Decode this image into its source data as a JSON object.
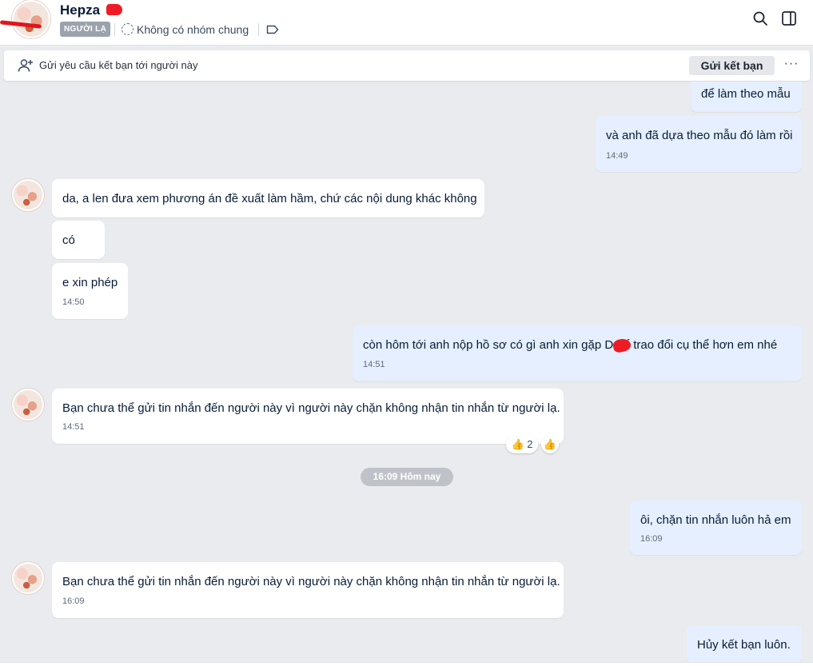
{
  "header": {
    "name": "Hepza",
    "badge": "NGƯỜI LẠ",
    "mutual_groups": "Không có nhóm chung",
    "icons": [
      "search-icon",
      "sidebar-toggle-icon",
      "tag-icon"
    ]
  },
  "friend_request_bar": {
    "text": "Gửi yêu cầu kết bạn tới người này",
    "button": "Gửi kết bạn",
    "more": "···"
  },
  "messages": [
    {
      "id": "m1",
      "dir": "out",
      "text": "để làm theo mẫu"
    },
    {
      "id": "m2",
      "dir": "out",
      "text": "và anh đã dựa theo mẫu đó làm rồi",
      "time": "14:49"
    },
    {
      "id": "m3",
      "dir": "in",
      "text": "da, a len đưa xem phương án đề xuất làm hầm,  chứ các nội dung khác không"
    },
    {
      "id": "m4",
      "dir": "in",
      "text": "có"
    },
    {
      "id": "m5",
      "dir": "in",
      "text": "e xin phép",
      "time": "14:50"
    },
    {
      "id": "m6",
      "dir": "out",
      "text": "còn hôm tới anh nộp hồ sơ có gì anh xin gặp D    để trao đổi cụ thể hơn em nhé",
      "time": "14:51"
    },
    {
      "id": "m7",
      "dir": "in",
      "text": "Bạn chưa thể gửi tin nhắn đến người này vì người này chặn không nhận tin nhắn từ người lạ.",
      "time": "14:51",
      "reactions": [
        {
          "emoji": "👍",
          "count": "2"
        },
        {
          "emoji": "👍"
        }
      ]
    },
    {
      "id": "m8",
      "dir": "out",
      "text": "ôi, chặn tin nhắn luôn hả em",
      "time": "16:09"
    },
    {
      "id": "m9",
      "dir": "in",
      "text": "Bạn chưa thể gửi tin nhắn đến người này vì người này chặn không nhận tin nhắn từ người lạ.",
      "time": "16:09"
    },
    {
      "id": "m10",
      "dir": "out",
      "text": "Hủy kết bạn luôn."
    }
  ],
  "date_divider": "16:09 Hôm nay",
  "colors": {
    "background": "#e9ebee",
    "outgoing_bubble": "#e5efff",
    "incoming_bubble": "#ffffff",
    "redaction": "#ef1b24"
  }
}
